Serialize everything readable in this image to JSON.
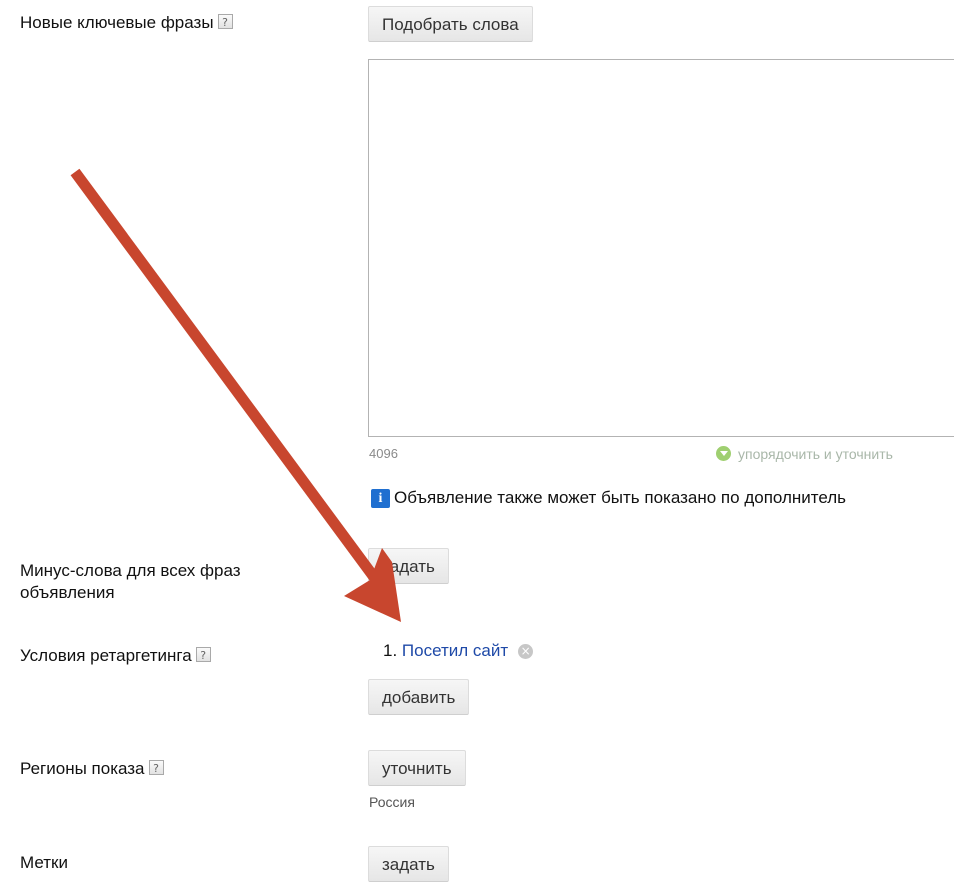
{
  "fields": {
    "keywords": {
      "label": "Новые ключевые фразы",
      "help": "?",
      "button": "Подобрать слова"
    },
    "textarea": {
      "counter": "4096",
      "sort_link": "упорядочить и уточнить"
    },
    "notice": {
      "icon": "i",
      "text": "Объявление также может быть показано по дополнитель"
    },
    "minus_words": {
      "label_line1": "Минус-слова для всех фраз",
      "label_line2": "объявления",
      "button": "задать"
    },
    "retargeting": {
      "label": "Условия ретаргетинга",
      "help": "?",
      "item_number": "1.",
      "item_link": "Посетил сайт",
      "remove": "×",
      "button": "добавить"
    },
    "regions": {
      "label": "Регионы показа",
      "help": "?",
      "button": "уточнить",
      "value": "Россия"
    },
    "tags": {
      "label": "Метки",
      "button": "задать"
    }
  },
  "colors": {
    "link": "#1f4aa8",
    "arrow": "#c8462e",
    "info": "#1f6fd0"
  },
  "icons": [
    "help-icon",
    "info-icon",
    "remove-icon",
    "arrow-annotation",
    "sort-icon"
  ]
}
